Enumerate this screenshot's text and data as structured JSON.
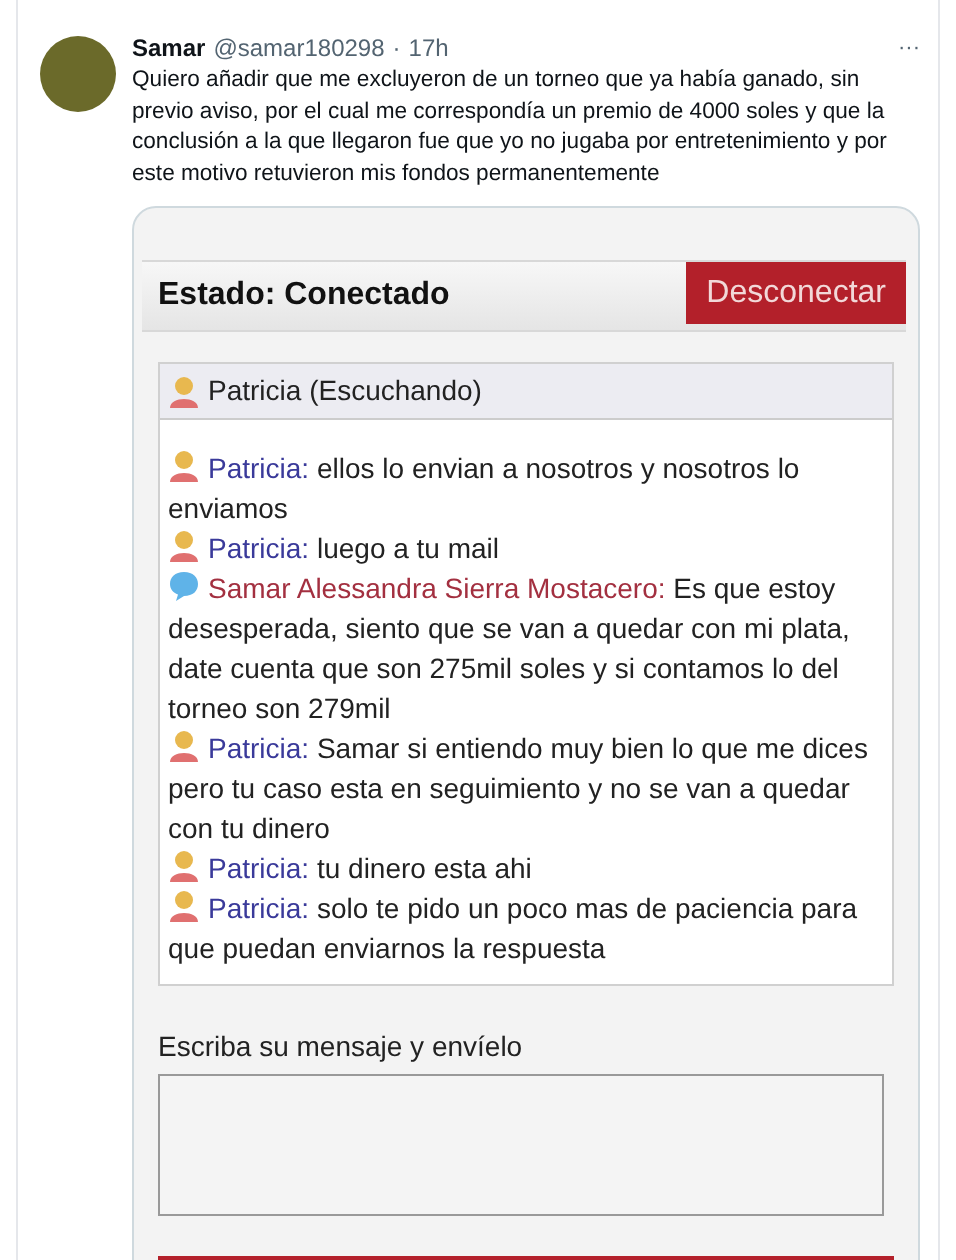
{
  "tweet": {
    "name": "Samar",
    "handle": "@samar180298",
    "separator": "·",
    "time": "17h",
    "more": "···",
    "text": "Quiero añadir que me excluyeron de un torneo que ya había ganado, sin previo aviso, por el cual me correspondía un premio de 4000 soles y que la conclusión a la que llegaron fue que yo no jugaba por entretenimiento y por este motivo retuvieron mis fondos permanentemente"
  },
  "chat": {
    "status": "Estado: Conectado",
    "disconnect_button": "Desconectar",
    "listener": "Patricia (Escuchando)",
    "messages": [
      {
        "kind": "agent",
        "sender": "Patricia:",
        "text": "ellos lo envian a nosotros y nosotros lo enviamos"
      },
      {
        "kind": "agent",
        "sender": "Patricia:",
        "text": "luego a tu mail"
      },
      {
        "kind": "user",
        "sender": "Samar Alessandra Sierra Mostacero:",
        "text": "Es que estoy desesperada, siento que se van a quedar con mi plata, date cuenta que son 275mil soles y si contamos lo del torneo son 279mil"
      },
      {
        "kind": "agent",
        "sender": "Patricia:",
        "text": "Samar si entiendo muy bien lo que me dices pero tu caso esta en seguimiento y no se van a quedar con tu dinero"
      },
      {
        "kind": "agent",
        "sender": "Patricia:",
        "text": "tu dinero esta ahi"
      },
      {
        "kind": "agent",
        "sender": "Patricia:",
        "text": "solo te pido un poco mas de paciencia para que puedan enviarnos la respuesta"
      }
    ],
    "input_label": "Escriba su mensaje y envíelo"
  }
}
